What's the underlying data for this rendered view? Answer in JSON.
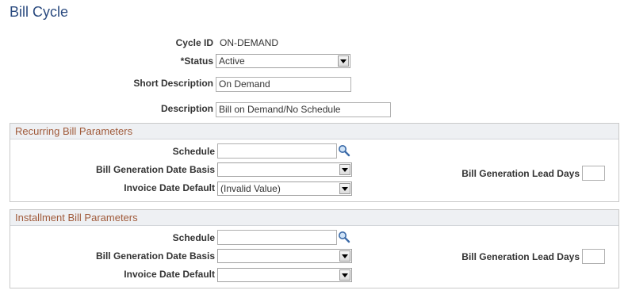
{
  "page": {
    "title": "Bill Cycle"
  },
  "header_fields": {
    "cycle_id_label": "Cycle ID",
    "cycle_id_value": "ON-DEMAND",
    "status_label": "*Status",
    "status_value": "Active",
    "short_desc_label": "Short Description",
    "short_desc_value": "On Demand",
    "description_label": "Description",
    "description_value": "Bill on Demand/No Schedule"
  },
  "recurring": {
    "title": "Recurring Bill Parameters",
    "schedule_label": "Schedule",
    "schedule_value": "",
    "basis_label": "Bill Generation Date Basis",
    "basis_value": "",
    "invoice_label": "Invoice Date Default",
    "invoice_value": "(Invalid Value)",
    "lead_days_label": "Bill Generation Lead Days",
    "lead_days_value": ""
  },
  "installment": {
    "title": "Installment Bill Parameters",
    "schedule_label": "Schedule",
    "schedule_value": "",
    "basis_label": "Bill Generation Date Basis",
    "basis_value": "",
    "invoice_label": "Invoice Date Default",
    "invoice_value": "",
    "lead_days_label": "Bill Generation Lead Days",
    "lead_days_value": ""
  },
  "icons": {
    "lookup": "magnifier-icon",
    "dropdown": "dropdown-arrow-icon"
  },
  "colors": {
    "title": "#2a4a7f",
    "group_title": "#a05a3a",
    "group_header_bg": "#eef0f3"
  }
}
